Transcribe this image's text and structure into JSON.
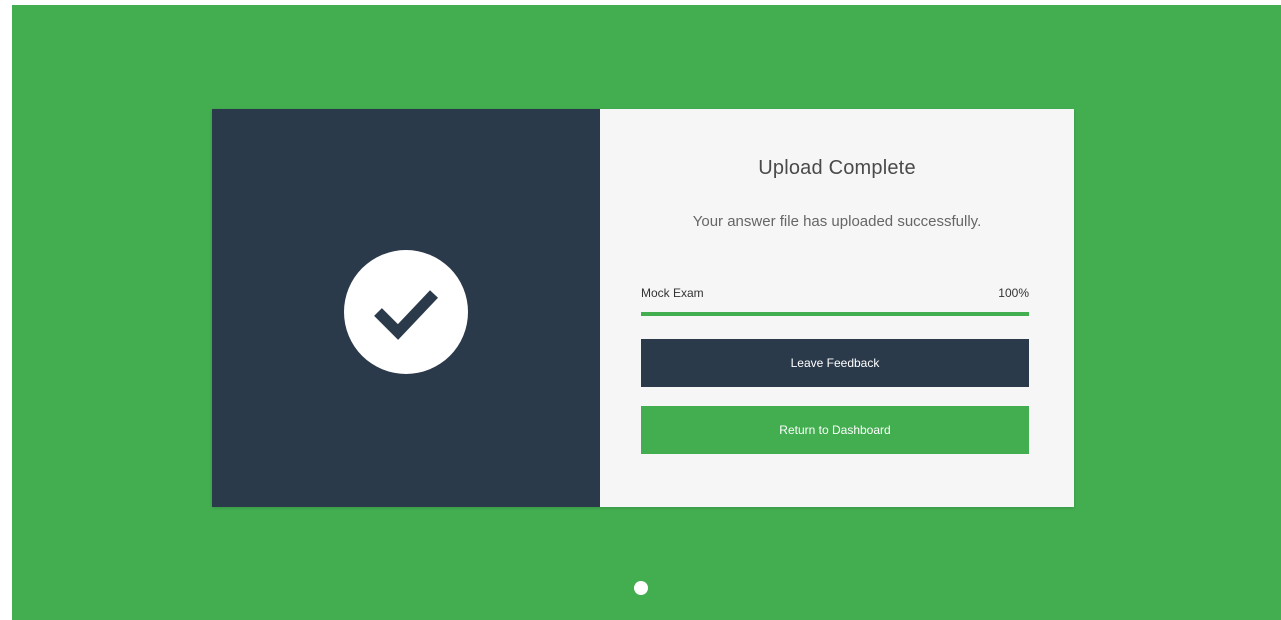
{
  "modal": {
    "title": "Upload Complete",
    "message": "Your answer file has uploaded successfully.",
    "progress": {
      "label": "Mock Exam",
      "percent_text": "100%",
      "value": 1.0
    },
    "buttons": {
      "feedback_label": "Leave Feedback",
      "dashboard_label": "Return to Dashboard"
    },
    "status_icon": "check-circle-icon"
  },
  "pager": {
    "dots": 1,
    "active_index": 0
  },
  "colors": {
    "background": "#43ae50",
    "left_panel": "#2b3a4a",
    "right_panel": "#f6f6f6",
    "accent": "#43ae50",
    "dark_button": "#2b3a4a"
  }
}
